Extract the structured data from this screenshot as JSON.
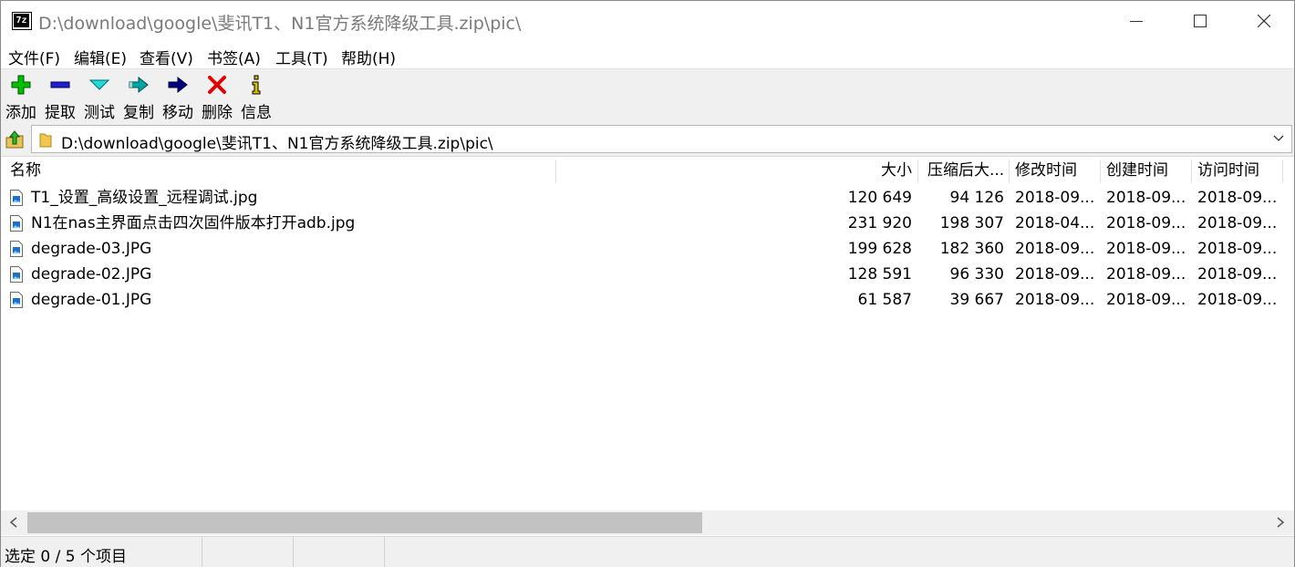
{
  "window": {
    "title": "D:\\download\\google\\斐讯T1、N1官方系统降级工具.zip\\pic\\",
    "app_icon_text": "7z"
  },
  "menu": [
    "文件(F)",
    "编辑(E)",
    "查看(V)",
    "书签(A)",
    "工具(T)",
    "帮助(H)"
  ],
  "toolbar": [
    {
      "label": "添加",
      "icon": "add-icon",
      "color": "#00c000"
    },
    {
      "label": "提取",
      "icon": "extract-icon",
      "color": "#1f1fcc"
    },
    {
      "label": "测试",
      "icon": "test-icon",
      "color": "#00c8c8"
    },
    {
      "label": "复制",
      "icon": "copy-icon",
      "color": "#009a9a"
    },
    {
      "label": "移动",
      "icon": "move-icon",
      "color": "#000080"
    },
    {
      "label": "删除",
      "icon": "delete-icon",
      "color": "#e00000"
    },
    {
      "label": "信息",
      "icon": "info-icon",
      "color": "#c8b400"
    }
  ],
  "address": {
    "path": "D:\\download\\google\\斐讯T1、N1官方系统降级工具.zip\\pic\\"
  },
  "columns": [
    "名称",
    "大小",
    "压缩后大...",
    "修改时间",
    "创建时间",
    "访问时间"
  ],
  "files": [
    {
      "name": "T1_设置_高级设置_远程调试.jpg",
      "size": "120 649",
      "packed": "94 126",
      "modified": "2018-09...",
      "created": "2018-09...",
      "accessed": "2018-09..."
    },
    {
      "name": "N1在nas主界面点击四次固件版本打开adb.jpg",
      "size": "231 920",
      "packed": "198 307",
      "modified": "2018-04...",
      "created": "2018-09...",
      "accessed": "2018-09..."
    },
    {
      "name": "degrade-03.JPG",
      "size": "199 628",
      "packed": "182 360",
      "modified": "2018-09...",
      "created": "2018-09...",
      "accessed": "2018-09..."
    },
    {
      "name": "degrade-02.JPG",
      "size": "128 591",
      "packed": "96 330",
      "modified": "2018-09...",
      "created": "2018-09...",
      "accessed": "2018-09..."
    },
    {
      "name": "degrade-01.JPG",
      "size": "61 587",
      "packed": "39 667",
      "modified": "2018-09...",
      "created": "2018-09...",
      "accessed": "2018-09..."
    }
  ],
  "status": {
    "selection": "选定 0 / 5 个项目"
  }
}
